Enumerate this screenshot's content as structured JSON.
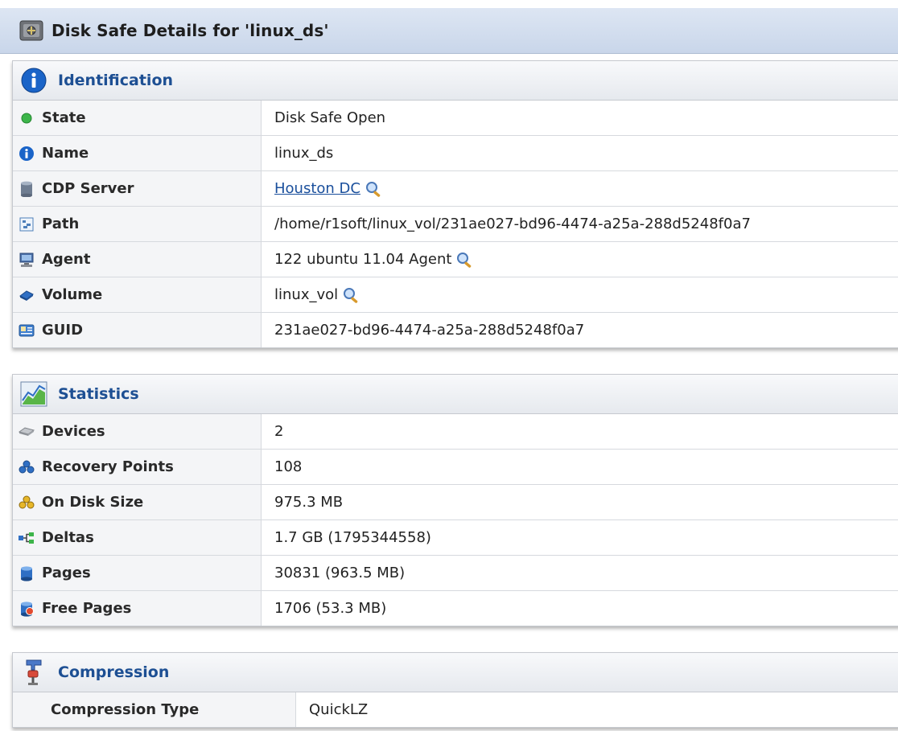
{
  "window": {
    "title": "Disk Safe Details for 'linux_ds'"
  },
  "identification": {
    "title": "Identification",
    "state": {
      "label": "State",
      "value": "Disk Safe Open"
    },
    "name": {
      "label": "Name",
      "value": "linux_ds"
    },
    "cdp_server": {
      "label": "CDP Server",
      "value": "Houston DC"
    },
    "path": {
      "label": "Path",
      "value": "/home/r1soft/linux_vol/231ae027-bd96-4474-a25a-288d5248f0a7"
    },
    "agent": {
      "label": "Agent",
      "value": "122 ubuntu 11.04 Agent"
    },
    "volume": {
      "label": "Volume",
      "value": "linux_vol"
    },
    "guid": {
      "label": "GUID",
      "value": "231ae027-bd96-4474-a25a-288d5248f0a7"
    }
  },
  "statistics": {
    "title": "Statistics",
    "devices": {
      "label": "Devices",
      "value": "2"
    },
    "recovery_points": {
      "label": "Recovery Points",
      "value": "108"
    },
    "on_disk_size": {
      "label": "On Disk Size",
      "value": "975.3 MB"
    },
    "deltas": {
      "label": "Deltas",
      "value": "1.7 GB (1795344558)"
    },
    "pages": {
      "label": "Pages",
      "value": "30831 (963.5 MB)"
    },
    "free_pages": {
      "label": "Free Pages",
      "value": "1706 (53.3 MB)"
    }
  },
  "compression": {
    "title": "Compression",
    "type": {
      "label": "Compression Type",
      "value": "QuickLZ"
    }
  },
  "colors": {
    "header_text": "#1d4f93",
    "link": "#1a4f9c",
    "state_ok": "#3db54a"
  }
}
